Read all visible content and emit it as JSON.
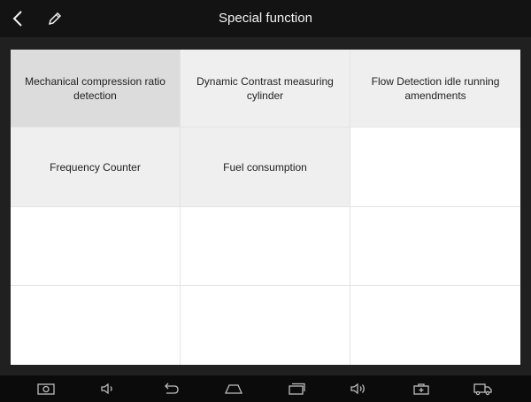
{
  "header": {
    "title": "Special function"
  },
  "icons": {
    "back": "back-arrow-icon",
    "edit": "pencil-icon"
  },
  "functions": [
    {
      "label": "Mechanical compression ratio detection",
      "selected": true
    },
    {
      "label": "Dynamic Contrast measuring cylinder",
      "selected": false
    },
    {
      "label": "Flow Detection idle running amendments",
      "selected": false
    },
    {
      "label": "Frequency Counter",
      "selected": false
    },
    {
      "label": "Fuel consumption",
      "selected": false
    }
  ],
  "navbar": {
    "icons": [
      "screenshot-icon",
      "volume-down-icon",
      "back-icon",
      "home-icon",
      "recent-apps-icon",
      "volume-up-icon",
      "toolbox-icon",
      "truck-icon"
    ]
  },
  "colors": {
    "selected_cell": "#dcdcdc",
    "filled_cell": "#efefef",
    "empty_cell": "#ffffff",
    "background": "#0f0f0f"
  }
}
